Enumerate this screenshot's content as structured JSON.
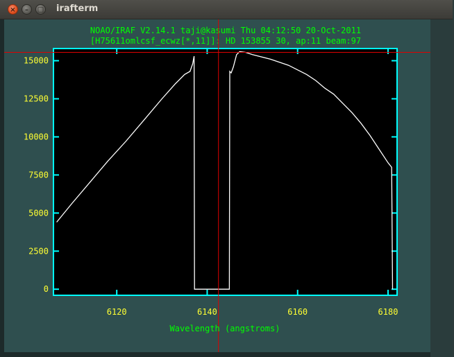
{
  "window": {
    "title": "irafterm",
    "close_glyph": "×",
    "minimize_glyph": "–",
    "maximize_glyph": "□"
  },
  "plot": {
    "header_line1": "NOAO/IRAF V2.14.1 taji@kasumi Thu 04:12:50 20-Oct-2011",
    "header_line2": "[H75611omlcsf_ecwz[*,11]]:  HD 153855 30, ap:11 beam:97",
    "frame_color": "#00ffff",
    "tick_label_color": "#ffff33",
    "text_color": "#00ff00",
    "cursor_color": "#e00000",
    "spectrum_color": "#ffffff"
  },
  "chart_data": {
    "type": "line",
    "title": "",
    "xlabel": "Wavelength (angstroms)",
    "ylabel": "",
    "xlim": [
      6106,
      6182
    ],
    "ylim": [
      -400,
      15800
    ],
    "xticks": [
      6120,
      6140,
      6160,
      6180
    ],
    "yticks": [
      0,
      2500,
      5000,
      7500,
      10000,
      12500,
      15000
    ],
    "xtick_labels": [
      "6120",
      "6140",
      "6160",
      "6180"
    ],
    "ytick_labels": [
      "0",
      "2500",
      "5000",
      "7500",
      "10000",
      "12500",
      "15000"
    ],
    "grid": false,
    "series": [
      {
        "x": [
          6106.7,
          6110,
          6114,
          6118,
          6122,
          6126,
          6130,
          6133,
          6135,
          6136.2,
          6136.8,
          6137.1,
          6137.2,
          6144.9,
          6145.0,
          6145.3,
          6145.8,
          6146.5,
          6147.2,
          6148.5,
          6150,
          6154,
          6158,
          6162,
          6164,
          6166,
          6168,
          6170,
          6172,
          6174,
          6176,
          6178,
          6180,
          6180.8,
          6181.0
        ],
        "y": [
          4400,
          5600,
          7000,
          8400,
          9700,
          11100,
          12500,
          13500,
          14100,
          14300,
          14800,
          15300,
          0,
          0,
          14300,
          14200,
          14600,
          15400,
          15600,
          15550,
          15400,
          15100,
          14700,
          14100,
          13700,
          13200,
          12800,
          12200,
          11600,
          10900,
          10100,
          9200,
          8300,
          8000,
          0
        ]
      }
    ],
    "cursor": {
      "x": 6142.5,
      "y": 15550
    }
  }
}
